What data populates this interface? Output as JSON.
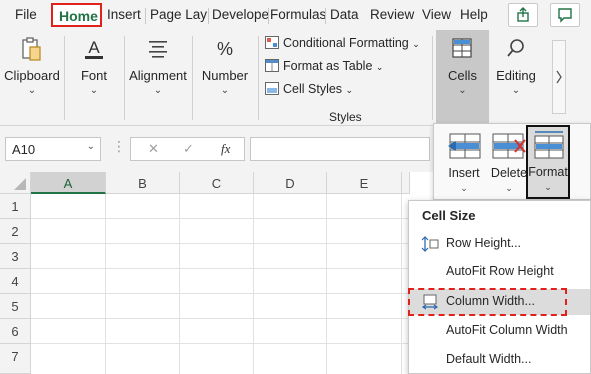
{
  "menu": {
    "tabs": [
      "File",
      "Home",
      "Insert",
      "Page Lay",
      "Develope",
      "Formulas",
      "Data",
      "Review",
      "View",
      "Help"
    ],
    "active_tab": "Home"
  },
  "ribbon": {
    "clipboard_label": "Clipboard",
    "font_label": "Font",
    "alignment_label": "Alignment",
    "number_label": "Number",
    "conditional_formatting": "Conditional Formatting",
    "format_as_table": "Format as Table",
    "cell_styles": "Cell Styles",
    "styles_group": "Styles",
    "cells_label": "Cells",
    "editing_label": "Editing",
    "chevron": "⌄",
    "number_symbol": "%",
    "font_symbol": "A"
  },
  "formula_bar": {
    "name_box": "A10",
    "cancel": "✕",
    "enter": "✓",
    "fx": "fx"
  },
  "grid": {
    "columns": [
      "A",
      "B",
      "C",
      "D",
      "E"
    ],
    "rows": [
      "1",
      "2",
      "3",
      "4",
      "5",
      "6",
      "7"
    ],
    "selected_column": "A"
  },
  "cells_popup": {
    "insert": "Insert",
    "delete": "Delete",
    "format": "Format"
  },
  "format_menu": {
    "header": "Cell Size",
    "items": [
      "Row Height...",
      "AutoFit Row Height",
      "Column Width...",
      "AutoFit Column Width",
      "Default Width..."
    ],
    "highlighted": "Column Width..."
  },
  "colors": {
    "accent_green": "#217346",
    "highlight_red": "#e0211c"
  }
}
